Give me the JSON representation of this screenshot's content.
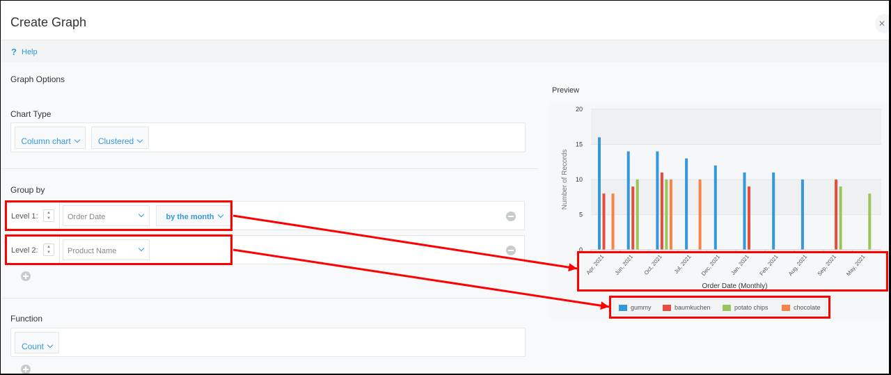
{
  "dialog": {
    "title": "Create Graph",
    "close_icon": "close-icon"
  },
  "help": {
    "icon": "question-icon",
    "glyph": "?",
    "label": "Help"
  },
  "graph_options": {
    "label": "Graph Options",
    "chart_type": {
      "label": "Chart Type",
      "type_value": "Column chart",
      "mode_value": "Clustered"
    },
    "group_by": {
      "label": "Group by",
      "levels": [
        {
          "label": "Level 1:",
          "field": "Order Date",
          "period": "by the month"
        },
        {
          "label": "Level 2:",
          "field": "Product Name"
        }
      ]
    },
    "function": {
      "label": "Function",
      "value": "Count"
    }
  },
  "preview": {
    "label": "Preview"
  },
  "chart_data": {
    "type": "bar",
    "title": "",
    "xlabel": "Order Date (Monthly)",
    "ylabel": "Number of Records",
    "ylim": [
      0,
      20
    ],
    "yticks": [
      0,
      5,
      10,
      15,
      20
    ],
    "grid": true,
    "legend_position": "bottom",
    "categories": [
      "Apr, 2021",
      "Jun, 2021",
      "Oct, 2021",
      "Jul, 2021",
      "Dec, 2021",
      "Jan, 2021",
      "Feb, 2021",
      "Aug, 2021",
      "Sep, 2021",
      "May, 2021"
    ],
    "series": [
      {
        "name": "gummy",
        "color": "#3498db",
        "values": [
          16,
          14,
          14,
          13,
          12,
          11,
          11,
          10,
          0,
          0
        ]
      },
      {
        "name": "baumkuchen",
        "color": "#e74c3c",
        "values": [
          8,
          9,
          11,
          0,
          0,
          9,
          0,
          0,
          10,
          0
        ]
      },
      {
        "name": "potato chips",
        "color": "#9bc55c",
        "values": [
          0,
          10,
          10,
          0,
          0,
          0,
          0,
          0,
          9,
          8
        ]
      },
      {
        "name": "chocolate",
        "color": "#f5834a",
        "values": [
          8,
          0,
          10,
          10,
          0,
          0,
          0,
          0,
          0,
          0
        ]
      }
    ]
  },
  "annotation_color": "#ff0000"
}
